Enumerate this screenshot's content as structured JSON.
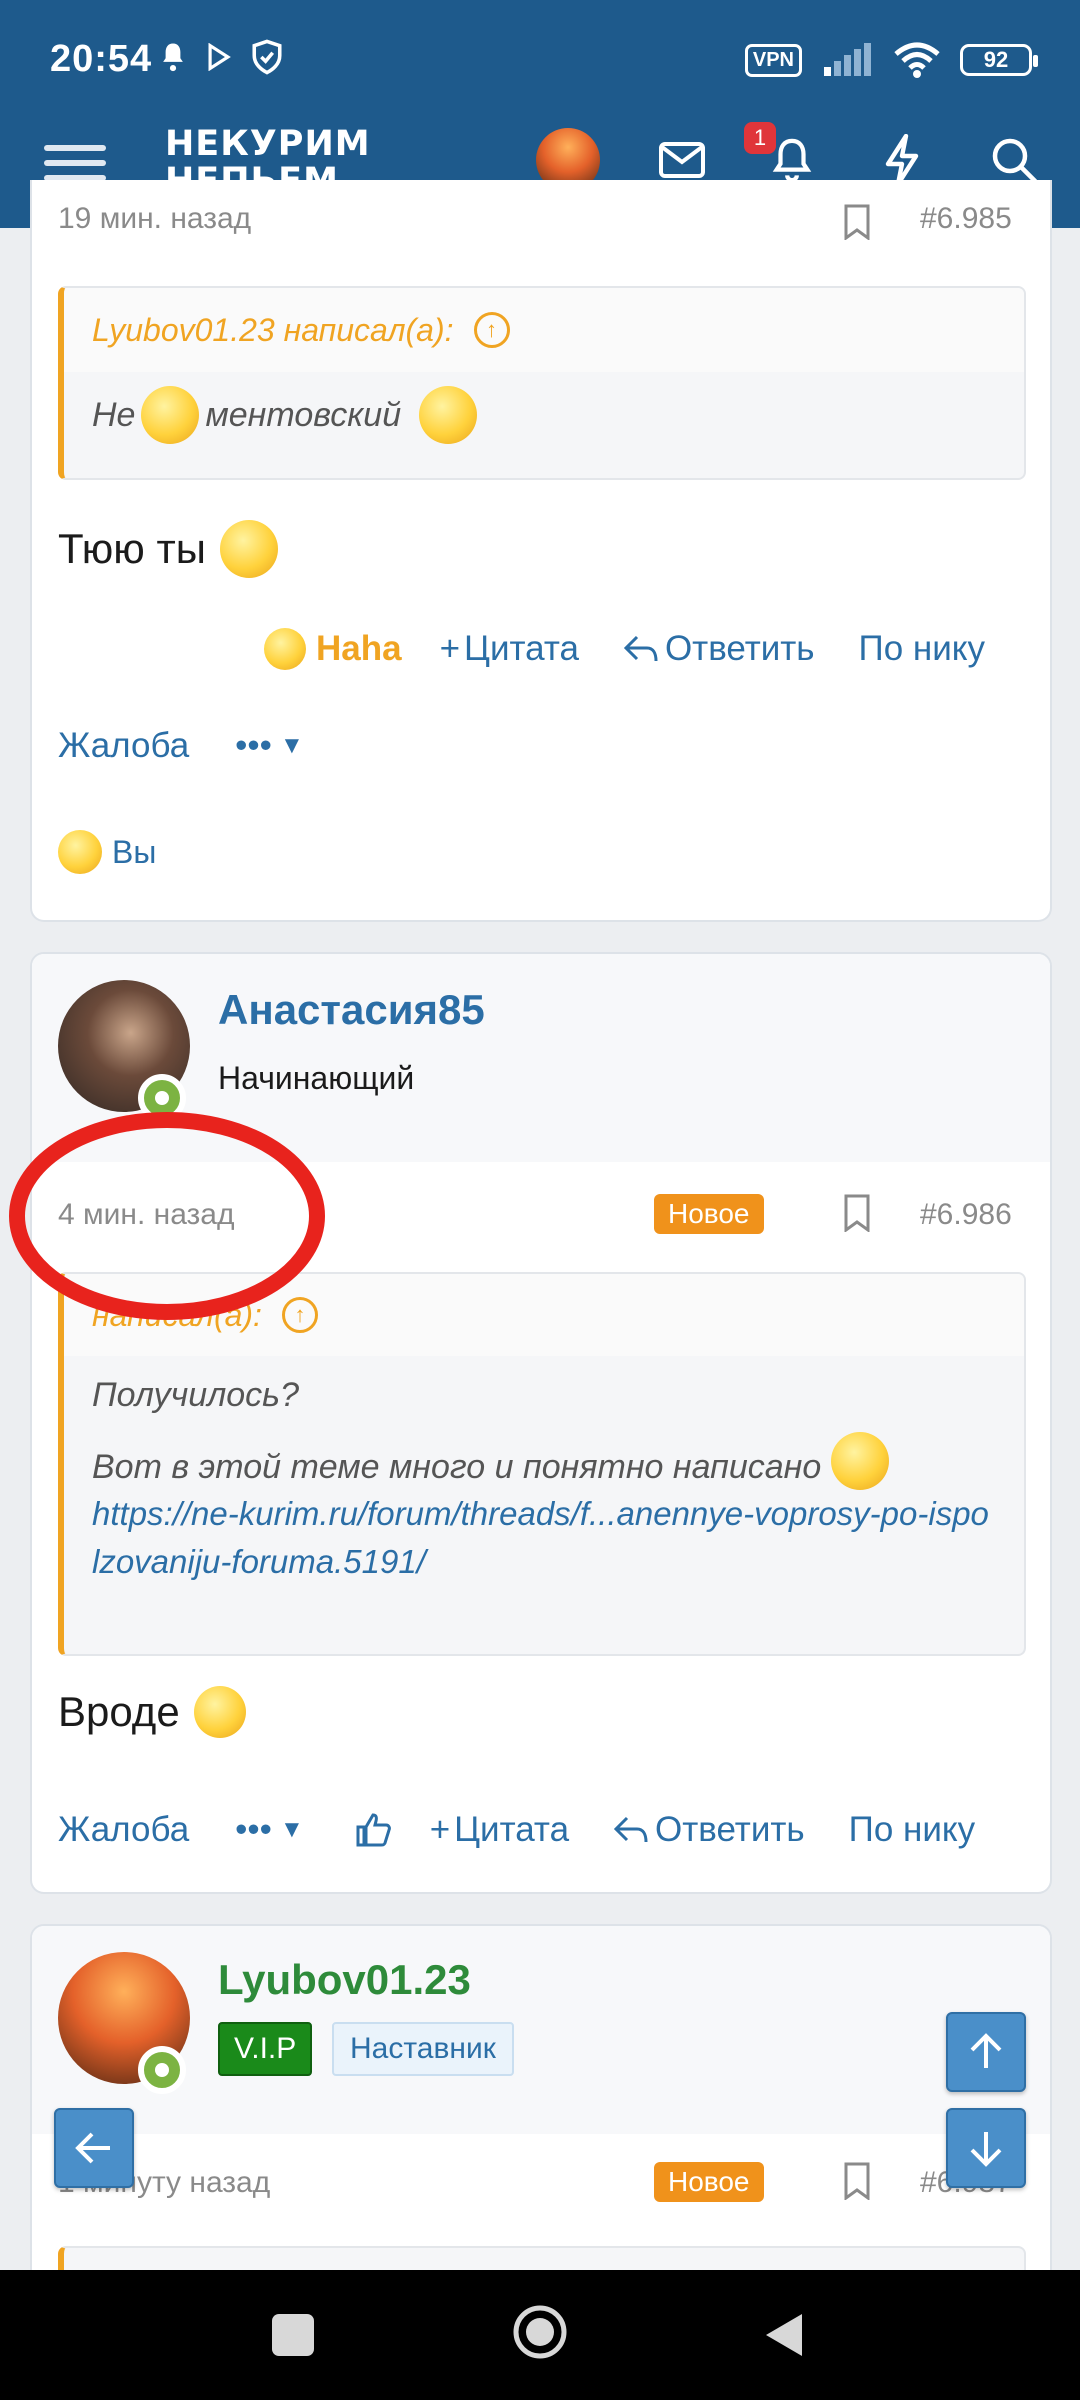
{
  "status": {
    "time": "20:54",
    "vpn": "VPN",
    "battery": "92"
  },
  "header": {
    "logo_line1": "НЕКУРИМ",
    "logo_line2": "НЕПЬЕМ...",
    "notif_count": "1"
  },
  "post_prev": {
    "time": "19 мин. назад",
    "number": "#6.985",
    "quote_author": "Lyubov01.23 написал(а):",
    "quote_word1": "Не",
    "quote_word2": "ментовский",
    "body": "Тюю ты",
    "reaction": "Haha",
    "quote_btn": "Цитата",
    "reply_btn": "Ответить",
    "by_nick_btn": "По нику",
    "report_btn": "Жалоба",
    "more_btn": "•••",
    "reacted_by": "Вы"
  },
  "post_main": {
    "username": "Анастасия85",
    "user_title": "Начинающий",
    "time": "4 мин. назад",
    "badge_new": "Новое",
    "number": "#6.986",
    "quote_author": "написал(а):",
    "quote_line1": "Получилось?",
    "quote_line2": "Вот в этой теме много и понятно написано",
    "quote_link": "https://ne-kurim.ru/forum/threads/f...anennye-voprosy-po-ispolzovaniju-foruma.5191/",
    "body": "Вроде",
    "report_btn": "Жалоба",
    "more_btn": "•••",
    "quote_btn": "Цитата",
    "reply_btn": "Ответить",
    "by_nick_btn": "По нику"
  },
  "post_next": {
    "username": "Lyubov01.23",
    "badge_vip": "V.I.P",
    "badge_mentor": "Наставник",
    "time": "1 минуту назад",
    "badge_new": "Новое",
    "number": "#6.987"
  },
  "colors": {
    "header": "#1e5a8c",
    "accent": "#2b6ea6",
    "quote_border": "#f0a422",
    "highlight_circle": "#e8231d",
    "vip": "#1a8a1a"
  }
}
